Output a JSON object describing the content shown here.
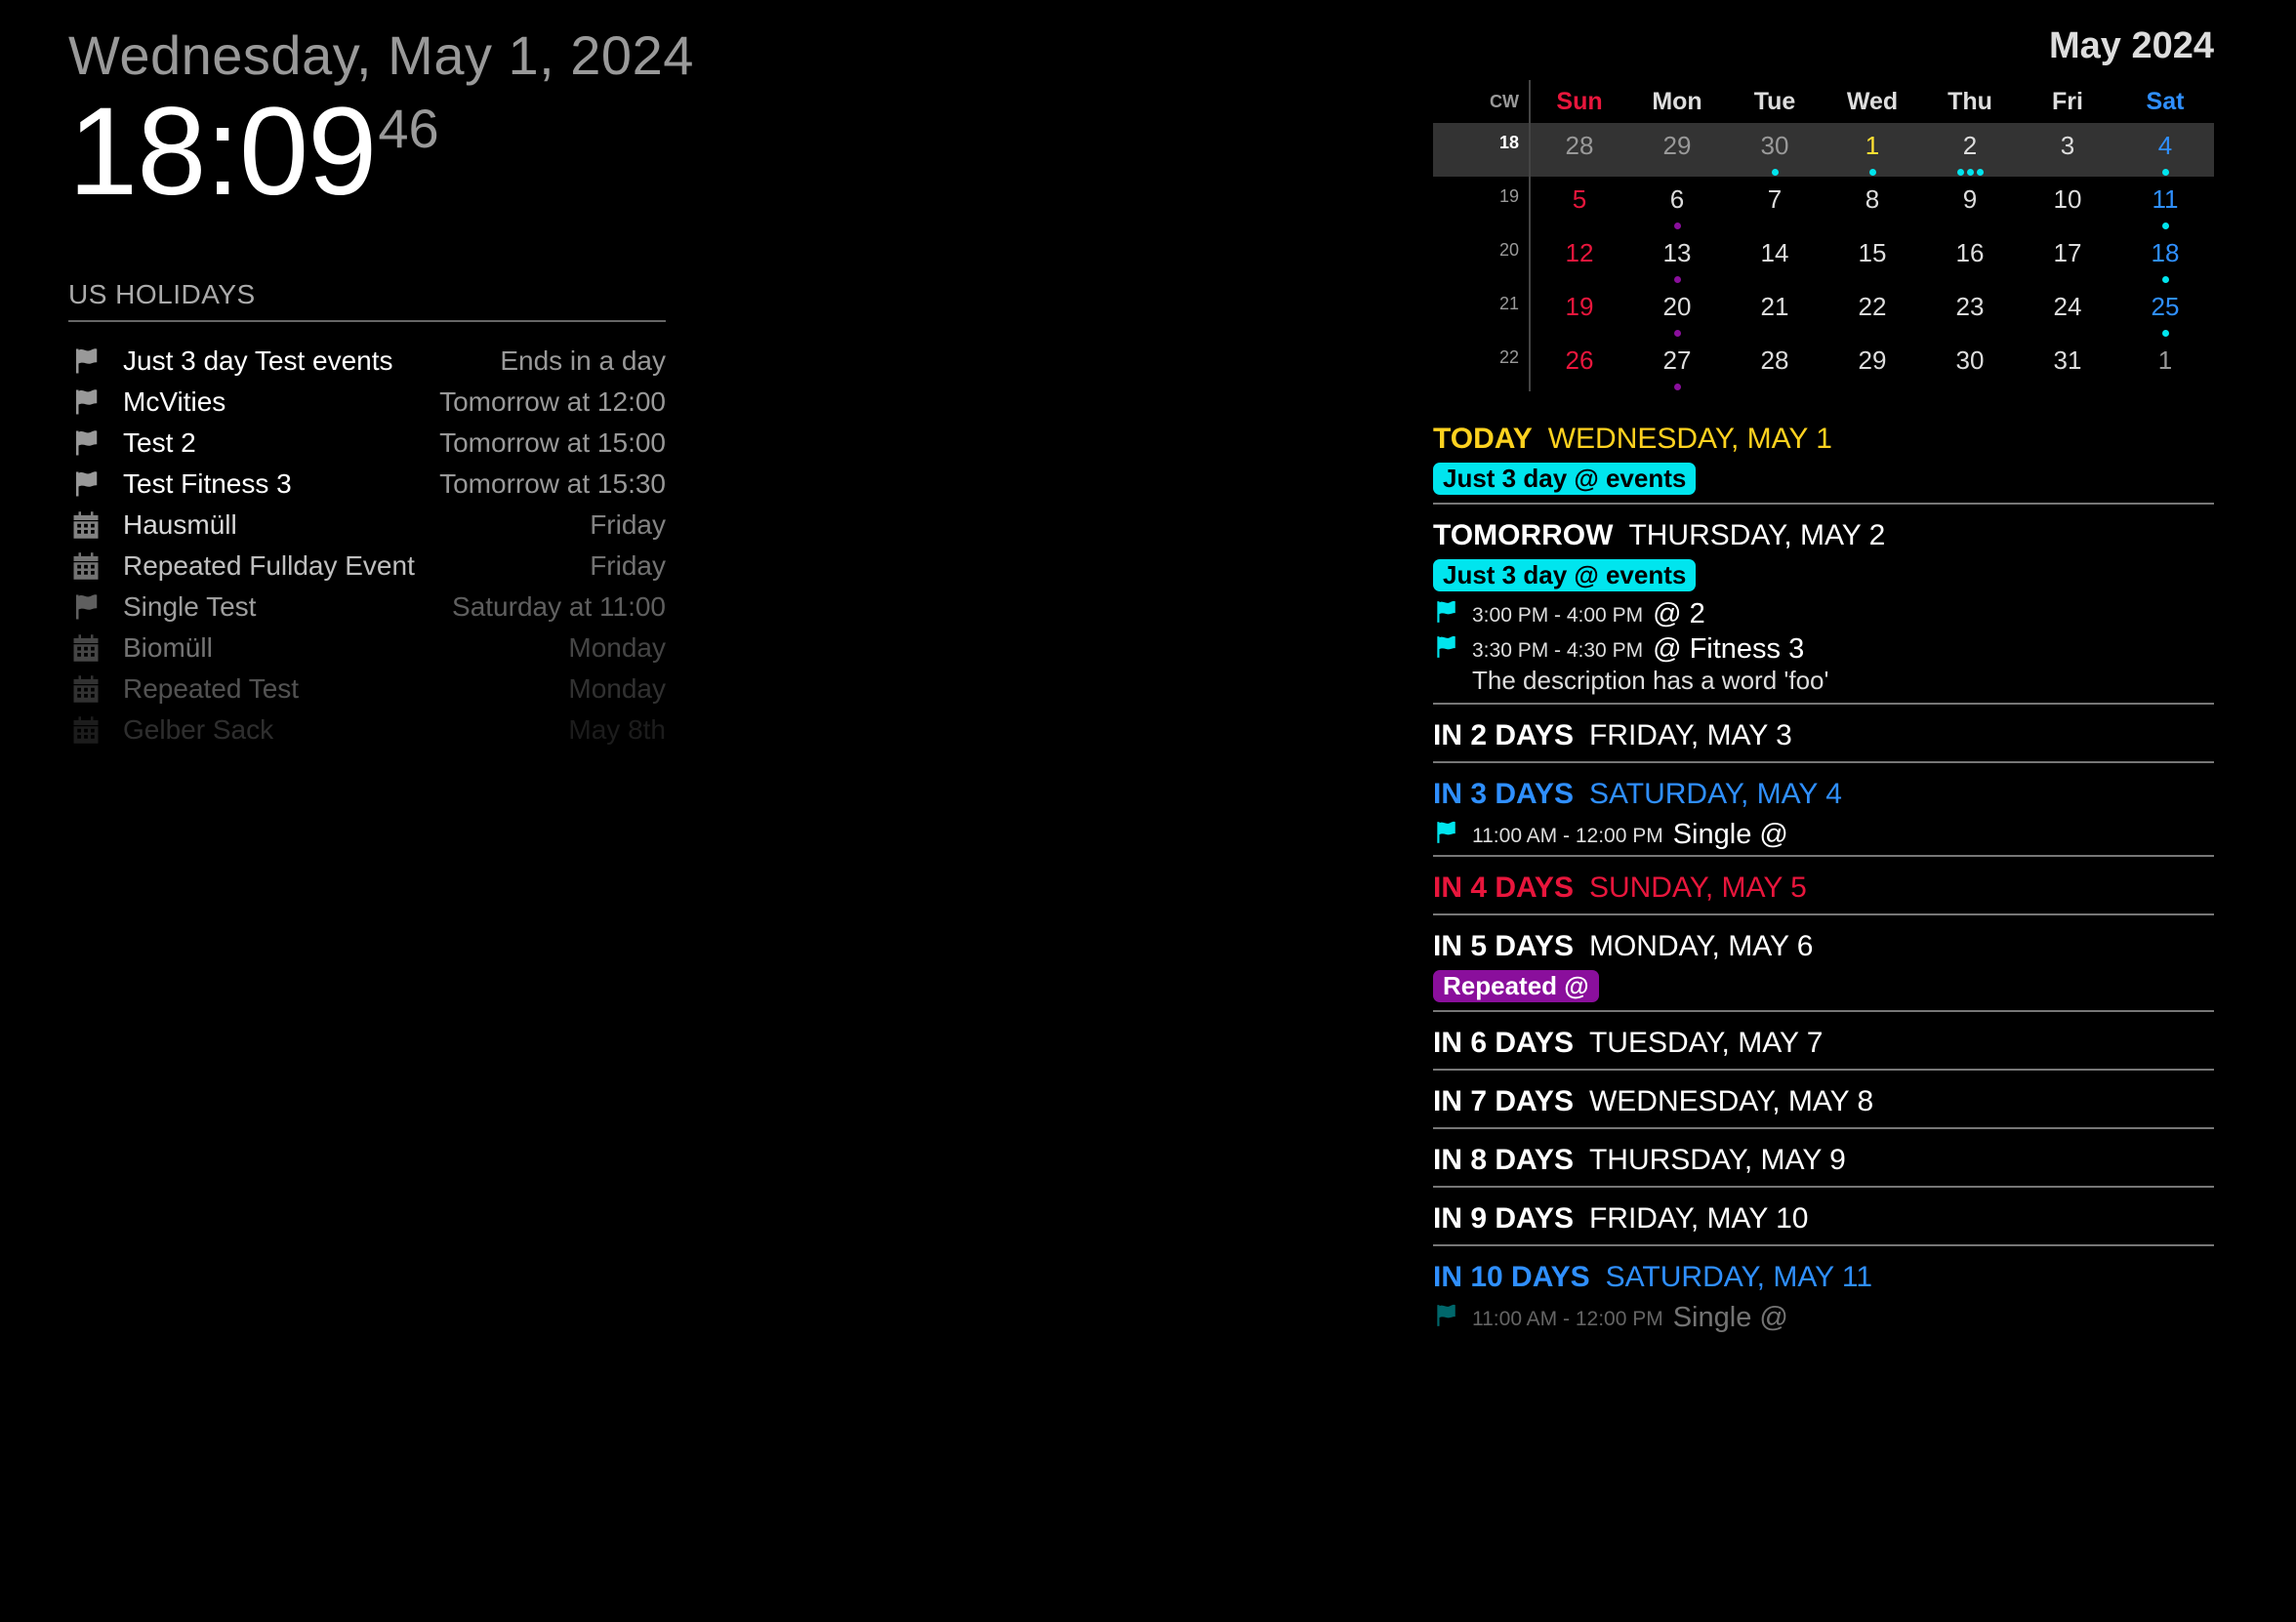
{
  "clock": {
    "date": "Wednesday, May 1, 2024",
    "time": "18:09",
    "seconds": "46"
  },
  "holidays": {
    "header": "US HOLIDAYS",
    "items": [
      {
        "icon": "flag-icon",
        "title": "Just 3 day Test events",
        "when": "Ends in a day",
        "opacity": 1
      },
      {
        "icon": "flag-icon",
        "title": "McVities",
        "when": "Tomorrow at 12:00",
        "opacity": 1
      },
      {
        "icon": "flag-icon",
        "title": "Test 2",
        "when": "Tomorrow at 15:00",
        "opacity": 1
      },
      {
        "icon": "flag-icon",
        "title": "Test Fitness 3",
        "when": "Tomorrow at 15:30",
        "opacity": 1
      },
      {
        "icon": "calendar-icon",
        "title": "Hausmüll",
        "when": "Friday",
        "opacity": 0.85
      },
      {
        "icon": "calendar-icon",
        "title": "Repeated Fullday Event",
        "when": "Friday",
        "opacity": 0.75
      },
      {
        "icon": "flag-icon",
        "title": "Single Test",
        "when": "Saturday at 11:00",
        "opacity": 0.62
      },
      {
        "icon": "calendar-icon",
        "title": "Biomüll",
        "when": "Monday",
        "opacity": 0.45
      },
      {
        "icon": "calendar-icon",
        "title": "Repeated Test",
        "when": "Monday",
        "opacity": 0.32
      },
      {
        "icon": "calendar-icon",
        "title": "Gelber Sack",
        "when": "May 8th",
        "opacity": 0.18
      }
    ]
  },
  "calendar": {
    "title": "May 2024",
    "cw_label": "CW",
    "day_names": [
      "Sun",
      "Mon",
      "Tue",
      "Wed",
      "Thu",
      "Fri",
      "Sat"
    ],
    "colors": {
      "sunday": "#e8163c",
      "saturday": "#2f8fff",
      "today": "#ffe033",
      "other_month": "#999999",
      "normal": "#dddddd",
      "cyan": "#00e5ee",
      "purple": "#8a0f9c"
    },
    "weeks": [
      {
        "cw": "18",
        "current": true,
        "days": [
          {
            "d": "28",
            "other": true
          },
          {
            "d": "29",
            "other": true
          },
          {
            "d": "30",
            "other": true,
            "dots": [
              "cyan"
            ]
          },
          {
            "d": "1",
            "today": true,
            "dots": [
              "cyan"
            ]
          },
          {
            "d": "2",
            "dots": [
              "cyan",
              "cyan",
              "cyan"
            ]
          },
          {
            "d": "3"
          },
          {
            "d": "4",
            "dots": [
              "cyan"
            ]
          }
        ]
      },
      {
        "cw": "19",
        "days": [
          {
            "d": "5"
          },
          {
            "d": "6",
            "dots": [
              "purple"
            ]
          },
          {
            "d": "7"
          },
          {
            "d": "8"
          },
          {
            "d": "9"
          },
          {
            "d": "10"
          },
          {
            "d": "11",
            "dots": [
              "cyan"
            ]
          }
        ]
      },
      {
        "cw": "20",
        "days": [
          {
            "d": "12"
          },
          {
            "d": "13",
            "dots": [
              "purple"
            ]
          },
          {
            "d": "14"
          },
          {
            "d": "15"
          },
          {
            "d": "16"
          },
          {
            "d": "17"
          },
          {
            "d": "18",
            "dots": [
              "cyan"
            ]
          }
        ]
      },
      {
        "cw": "21",
        "days": [
          {
            "d": "19"
          },
          {
            "d": "20",
            "dots": [
              "purple"
            ]
          },
          {
            "d": "21"
          },
          {
            "d": "22"
          },
          {
            "d": "23"
          },
          {
            "d": "24"
          },
          {
            "d": "25",
            "dots": [
              "cyan"
            ]
          }
        ]
      },
      {
        "cw": "22",
        "days": [
          {
            "d": "26"
          },
          {
            "d": "27",
            "dots": [
              "purple"
            ]
          },
          {
            "d": "28"
          },
          {
            "d": "29"
          },
          {
            "d": "30"
          },
          {
            "d": "31"
          },
          {
            "d": "1",
            "other": true
          }
        ]
      }
    ]
  },
  "agenda": {
    "days": [
      {
        "rel": "TODAY",
        "date": "WEDNESDAY, MAY 1",
        "color": "#ffd21f",
        "pills": [
          {
            "label": "Just 3 day @ events",
            "color": "#00e5ee"
          }
        ],
        "events": []
      },
      {
        "rel": "TOMORROW",
        "date": "THURSDAY, MAY 2",
        "color": "#ffffff",
        "pills": [
          {
            "label": "Just 3 day @ events",
            "color": "#00e5ee"
          }
        ],
        "events": [
          {
            "time": "3:00 PM -  4:00 PM",
            "name": "@ 2",
            "flag_color": "#00e5ee"
          },
          {
            "time": "3:30 PM -  4:30 PM",
            "name": "@ Fitness 3",
            "flag_color": "#00e5ee",
            "desc": "The description has a word 'foo'"
          }
        ]
      },
      {
        "rel": "IN 2 DAYS",
        "date": "FRIDAY, MAY 3",
        "color": "#ffffff",
        "pills": [],
        "events": []
      },
      {
        "rel": "IN 3 DAYS",
        "date": "SATURDAY, MAY 4",
        "color": "#2f8fff",
        "pills": [],
        "events": [
          {
            "time": "11:00 AM -  12:00 PM",
            "name": "Single @",
            "flag_color": "#00e5ee"
          }
        ]
      },
      {
        "rel": "IN 4 DAYS",
        "date": "SUNDAY, MAY 5",
        "color": "#e8163c",
        "pills": [],
        "events": []
      },
      {
        "rel": "IN 5 DAYS",
        "date": "MONDAY, MAY 6",
        "color": "#ffffff",
        "pills": [
          {
            "label": "Repeated @",
            "color": "#8a0f9c",
            "text_color": "#ffffff"
          }
        ],
        "events": []
      },
      {
        "rel": "IN 6 DAYS",
        "date": "TUESDAY, MAY 7",
        "color": "#ffffff",
        "pills": [],
        "events": []
      },
      {
        "rel": "IN 7 DAYS",
        "date": "WEDNESDAY, MAY 8",
        "color": "#ffffff",
        "pills": [],
        "events": []
      },
      {
        "rel": "IN 8 DAYS",
        "date": "THURSDAY, MAY 9",
        "color": "#ffffff",
        "pills": [],
        "events": []
      },
      {
        "rel": "IN 9 DAYS",
        "date": "FRIDAY, MAY 10",
        "color": "#ffffff",
        "pills": [],
        "events": []
      },
      {
        "rel": "IN 10 DAYS",
        "date": "SATURDAY, MAY 11",
        "color": "#2f8fff",
        "pills": [],
        "last": true,
        "events": [
          {
            "time": "11:00 AM -  12:00 PM",
            "name": "Single @",
            "flag_color": "#00e5ee",
            "faded": true
          }
        ]
      }
    ]
  }
}
